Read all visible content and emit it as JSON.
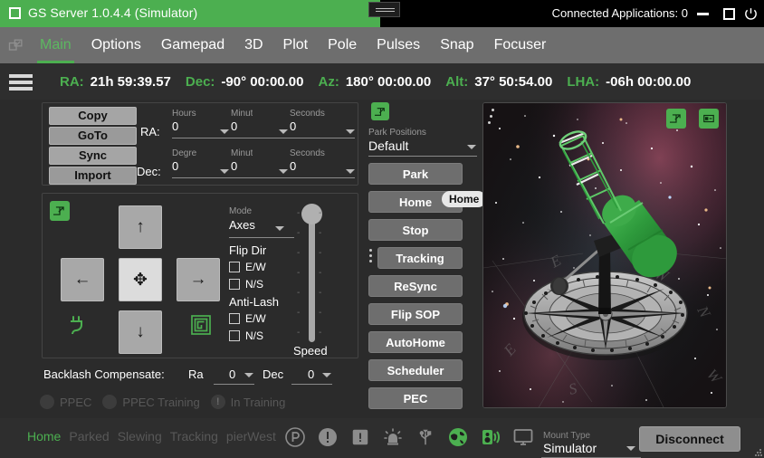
{
  "titlebar": {
    "app_title": "GS Server 1.0.4.4 (Simulator)",
    "connected_apps": "Connected Applications: 0",
    "minimize_icon": "minimize-icon",
    "maximize_icon": "maximize-icon",
    "power_icon": "power-icon"
  },
  "tabs": [
    {
      "label": "Main",
      "active": true
    },
    {
      "label": "Options",
      "active": false
    },
    {
      "label": "Gamepad",
      "active": false
    },
    {
      "label": "3D",
      "active": false
    },
    {
      "label": "Plot",
      "active": false
    },
    {
      "label": "Pole",
      "active": false
    },
    {
      "label": "Pulses",
      "active": false
    },
    {
      "label": "Snap",
      "active": false
    },
    {
      "label": "Focuser",
      "active": false
    }
  ],
  "coordinates": [
    {
      "label": "RA:",
      "value": "21h 59:39.57"
    },
    {
      "label": "Dec:",
      "value": "-90° 00:00.00"
    },
    {
      "label": "Az:",
      "value": "180° 00:00.00"
    },
    {
      "label": "Alt:",
      "value": "37° 50:54.00"
    },
    {
      "label": "LHA:",
      "value": "-06h 00:00.00"
    }
  ],
  "goto_panel": {
    "buttons": [
      "Copy",
      "GoTo",
      "Sync",
      "Import"
    ],
    "ra_label": "RA:",
    "dec_label": "Dec:",
    "ra_fields": [
      {
        "caption": "Hours",
        "value": "0"
      },
      {
        "caption": "Minut",
        "value": "0"
      },
      {
        "caption": "Seconds",
        "value": "0"
      }
    ],
    "dec_fields": [
      {
        "caption": "Degre",
        "value": "0"
      },
      {
        "caption": "Minut",
        "value": "0"
      },
      {
        "caption": "Seconds",
        "value": "0"
      }
    ]
  },
  "dpad_panel": {
    "up": "↑",
    "down": "↓",
    "left": "←",
    "right": "→",
    "center": "✥",
    "mode_caption": "Mode",
    "mode_value": "Axes",
    "flip_dir_header": "Flip Dir",
    "flip_ew": "E/W",
    "flip_ns": "N/S",
    "antilash_header": "Anti-Lash",
    "antilash_ew": "E/W",
    "antilash_ns": "N/S",
    "speed_label": "Speed",
    "tick_mark": "-"
  },
  "backlash": {
    "label": "Backlash Compensate:",
    "ra_label": "Ra",
    "ra_value": "0",
    "dec_label": "Dec",
    "dec_value": "0"
  },
  "ppec": {
    "ppec_label": "PPEC",
    "training_label": "PPEC Training",
    "in_training_label": "In Training",
    "in_training_icon": "stopwatch-icon"
  },
  "center_column": {
    "park_positions_caption": "Park Positions",
    "park_positions_value": "Default",
    "buttons": [
      "Park",
      "Home",
      "Stop",
      "Tracking",
      "ReSync",
      "Flip SOP",
      "AutoHome",
      "Scheduler",
      "PEC"
    ],
    "tooltip": "Home"
  },
  "sky_panel": {
    "popout_icon": "popout-icon",
    "window_icon": "window-icon",
    "drag_handle_icon": "drag-dots-icon"
  },
  "status_bar": {
    "words": [
      {
        "label": "Home",
        "active": true
      },
      {
        "label": "Parked",
        "active": false
      },
      {
        "label": "Slewing",
        "active": false
      },
      {
        "label": "Tracking",
        "active": false
      },
      {
        "label": "pierWest",
        "active": false
      }
    ],
    "icons": [
      {
        "name": "park-circle-icon",
        "active": false
      },
      {
        "name": "alert-circle-icon",
        "active": false
      },
      {
        "name": "alert-square-icon",
        "active": false
      },
      {
        "name": "siren-icon",
        "active": false
      },
      {
        "name": "usb-icon",
        "active": false
      },
      {
        "name": "globe-icon",
        "active": true
      },
      {
        "name": "volume-icon",
        "active": true
      },
      {
        "name": "monitor-icon",
        "active": false
      }
    ],
    "mount_type_caption": "Mount Type",
    "mount_type_value": "Simulator",
    "disconnect_label": "Disconnect"
  },
  "colors": {
    "accent_green": "#4caf50",
    "titlebar_black": "#000000",
    "tabbar_gray": "#6e6e6e",
    "panel_bg": "#2b2b2b",
    "button_gray": "#6e6e6e",
    "light_button": "#a8a8a8"
  }
}
